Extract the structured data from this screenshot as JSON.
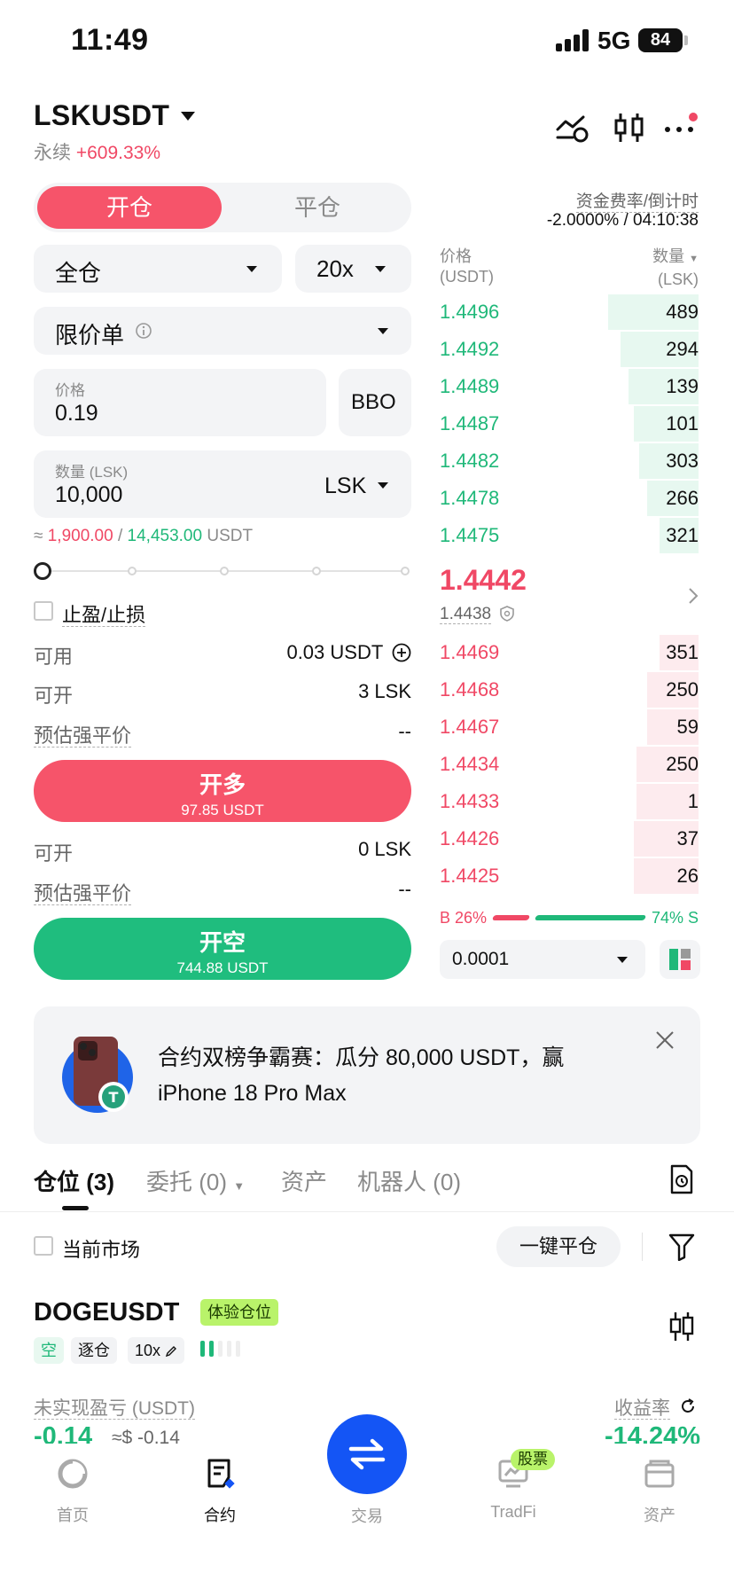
{
  "status": {
    "time": "11:49",
    "network": "5G",
    "battery": "84"
  },
  "header": {
    "pair": "LSKUSDT",
    "type": "永续",
    "change": "+609.33%"
  },
  "tabs": {
    "open": "开仓",
    "close": "平仓"
  },
  "funding": {
    "label": "资金费率/倒计时",
    "value": "-2.0000% / 04:10:38"
  },
  "form": {
    "margin_mode": "全仓",
    "leverage": "20x",
    "order_type": "限价单",
    "price_label": "价格",
    "price_value": "0.19",
    "bbo": "BBO",
    "qty_label": "数量 (LSK)",
    "qty_value": "10,000",
    "qty_unit": "LSK",
    "approx_prefix": "≈",
    "approx_long": "1,900.00",
    "approx_sep": "/",
    "approx_short": "14,453.00",
    "approx_unit": "USDT",
    "tpsl": "止盈/止损",
    "available_label": "可用",
    "available_value": "0.03 USDT",
    "can_open_label": "可开",
    "can_open_long": "3 LSK",
    "liq_label": "预估强平价",
    "liq_long": "--",
    "long_btn": "开多",
    "long_amount": "97.85 USDT",
    "can_open_short": "0 LSK",
    "liq_short": "--",
    "short_btn": "开空",
    "short_amount": "744.88 USDT"
  },
  "orderbook": {
    "price_header": "价格",
    "price_unit": "(USDT)",
    "qty_header": "数量",
    "qty_unit": "(LSK)",
    "asks": [
      {
        "price": "1.4496",
        "qty": "489",
        "depth": 0.35
      },
      {
        "price": "1.4492",
        "qty": "294",
        "depth": 0.3
      },
      {
        "price": "1.4489",
        "qty": "139",
        "depth": 0.27
      },
      {
        "price": "1.4487",
        "qty": "101",
        "depth": 0.25
      },
      {
        "price": "1.4482",
        "qty": "303",
        "depth": 0.23
      },
      {
        "price": "1.4478",
        "qty": "266",
        "depth": 0.2
      },
      {
        "price": "1.4475",
        "qty": "321",
        "depth": 0.15
      }
    ],
    "last_price": "1.4442",
    "mark_price": "1.4438",
    "bids": [
      {
        "price": "1.4469",
        "qty": "351",
        "depth": 0.15
      },
      {
        "price": "1.4468",
        "qty": "250",
        "depth": 0.2
      },
      {
        "price": "1.4467",
        "qty": "59",
        "depth": 0.2
      },
      {
        "price": "1.4434",
        "qty": "250",
        "depth": 0.24
      },
      {
        "price": "1.4433",
        "qty": "1",
        "depth": 0.24
      },
      {
        "price": "1.4426",
        "qty": "37",
        "depth": 0.25
      },
      {
        "price": "1.4425",
        "qty": "26",
        "depth": 0.25
      }
    ],
    "buy_ratio": "B 26%",
    "sell_ratio": "74% S",
    "buy_share": 0.26,
    "precision": "0.0001"
  },
  "banner": {
    "text": "合约双榜争霸赛：瓜分 80,000 USDT，赢 iPhone 18 Pro Max"
  },
  "positions_tabs": [
    {
      "label": "仓位 (3)"
    },
    {
      "label": "委托 (0)"
    },
    {
      "label": "资产"
    },
    {
      "label": "机器人 (0)"
    }
  ],
  "filter": {
    "current_market": "当前市场",
    "close_all": "一键平仓"
  },
  "position": {
    "symbol": "DOGEUSDT",
    "badge": "体验仓位",
    "side": "空",
    "margin": "逐仓",
    "leverage": "10x",
    "pnl_label": "未实现盈亏 (USDT)",
    "pnl_value": "-0.14",
    "pnl_usd": "≈$ -0.14",
    "roe_label": "收益率",
    "roe_value": "-14.24%"
  },
  "nav": {
    "home": "首页",
    "contract": "合约",
    "trade": "交易",
    "tradfi": "TradFi",
    "tradfi_badge": "股票",
    "assets": "资产"
  },
  "colors": {
    "green": "#1fb879",
    "red": "#f04865",
    "accent_blue": "#1455f5"
  }
}
